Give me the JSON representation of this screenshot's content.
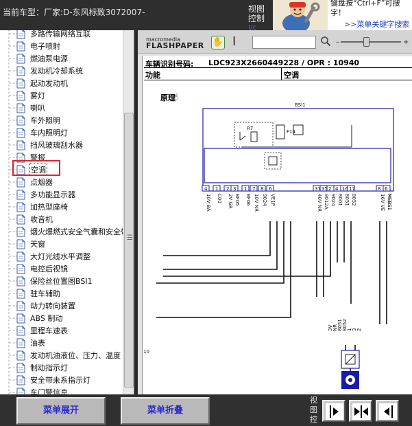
{
  "header": {
    "car_model_label": "当前车型：",
    "car_model_value": "厂家:D-东风标致3072007-",
    "view_control": [
      "视图",
      "控制"
    ],
    "view_control_tail": "I/c",
    "help_text_line1": "键盘按“Ctrl+F”可搜",
    "help_text_line2": "字！",
    "help_link": ">>菜单关键字搜索"
  },
  "sidebar": {
    "items": [
      {
        "label": "多路传输网络互联"
      },
      {
        "label": "电子喷射"
      },
      {
        "label": "燃油泵电源"
      },
      {
        "label": "发动机冷却系统"
      },
      {
        "label": "起动发动机"
      },
      {
        "label": "雾灯"
      },
      {
        "label": "喇叭"
      },
      {
        "label": "车外照明"
      },
      {
        "label": "车内照明灯"
      },
      {
        "label": "挡风玻璃刮水器"
      },
      {
        "label": "警报"
      },
      {
        "label": "空调",
        "selected": true
      },
      {
        "label": "点烟器"
      },
      {
        "label": "多功能显示器"
      },
      {
        "label": "加热型座椅"
      },
      {
        "label": "收音机"
      },
      {
        "label": "烟火爆燃式安全气囊和安全带"
      },
      {
        "label": "天窗"
      },
      {
        "label": "大灯光线水平调整"
      },
      {
        "label": "电控后视镜"
      },
      {
        "label": "保险丝位置图BSI1"
      },
      {
        "label": "驻车辅助"
      },
      {
        "label": "动力转向装置"
      },
      {
        "label": "ABS 制动"
      },
      {
        "label": "里程车速表"
      },
      {
        "label": "油表"
      },
      {
        "label": "发动机油液位、压力、温度"
      },
      {
        "label": "制动指示灯"
      },
      {
        "label": "安全带未系指示灯"
      },
      {
        "label": "车门警信息"
      }
    ]
  },
  "viewer": {
    "logo_top": "macromedia",
    "logo_main": "FLASHPAPER",
    "search_value": "",
    "vin_label": "车辆识别号码:",
    "vin_value": "LDC923X2660449228 / OPR : 10940",
    "func_label": "功能",
    "func_value": "空调",
    "section_title": "原理",
    "diagram": {
      "unit_label": "BSI1",
      "relay_label": "R7",
      "fuse_label": "F14",
      "pins_left": [
        "4",
        "1",
        "2",
        "3",
        "1",
        "7",
        "8",
        "6"
      ],
      "pins_right": [
        "37",
        "35",
        "2",
        "4",
        "16",
        "17",
        "8",
        "6"
      ],
      "wire_labels_left": [
        "10V BA",
        "C00",
        "2V GR",
        "BF05",
        "BF06",
        "10V NR",
        "9024",
        "VE1P"
      ],
      "wire_labels_right": [
        "40V NR",
        "9012A",
        "9024",
        "8001",
        "8051",
        "8052",
        "16V VE",
        "MEBS1",
        "MEBS1"
      ],
      "lower_labels": [
        "3V",
        "NR",
        "8051",
        "8052",
        "1",
        "3",
        "2"
      ],
      "side_label": "10"
    }
  },
  "footer": {
    "expand_label": "菜单展开",
    "collapse_label": "菜单折叠",
    "view_control": [
      "视",
      "图",
      "控"
    ]
  },
  "colors": {
    "selection_outline": "#e0232b",
    "button_text": "#2a2ad0",
    "diagram_blue": "#1a1aa8"
  }
}
